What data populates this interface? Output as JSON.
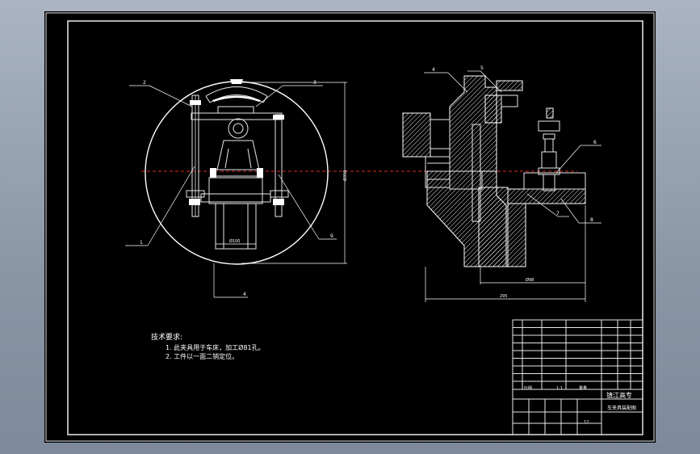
{
  "colors": {
    "background": "#000000",
    "lines": "#ffffff",
    "centerline": "#e03020",
    "frame": "#ffffff"
  },
  "notes": {
    "heading": "技术要求:",
    "items": [
      "1. 此夹具用于车床，加工Ø81孔。",
      "2. 工件以一面二销定位。"
    ]
  },
  "left_view_labels": {
    "l1": "1",
    "l2": "2",
    "l3": "3",
    "l4": "4",
    "l9": "9",
    "dim_a": "Ø100",
    "dim_b": "Ø350"
  },
  "right_view_labels": {
    "l4": "4",
    "l5": "5",
    "l6": "6",
    "l7": "7",
    "l8": "8",
    "dim_a": "Ø98",
    "dim_b": "295"
  },
  "title_block": {
    "company": "镇江高专",
    "drawing_name": "车夹具装配图",
    "scale_label": "比例",
    "scale": "1:1",
    "sheet_label": "重量",
    "count": "12"
  }
}
